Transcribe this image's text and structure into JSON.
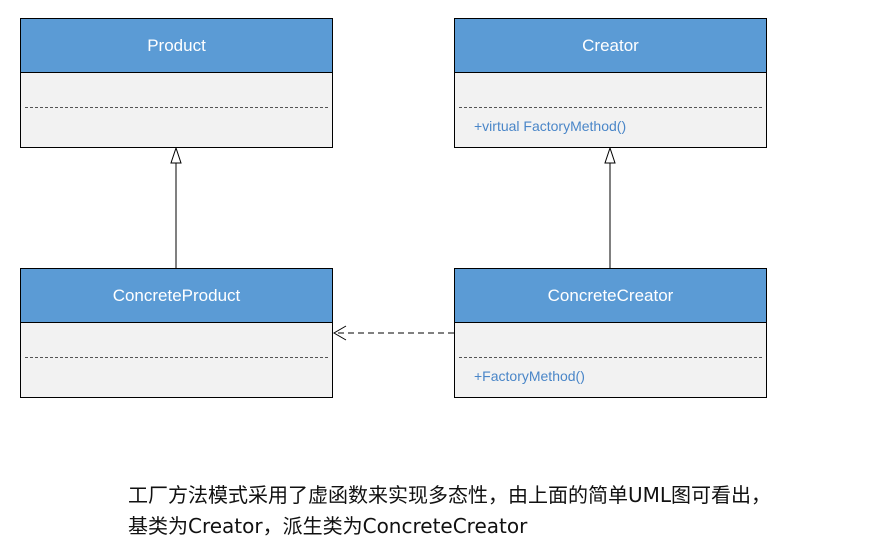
{
  "classes": {
    "product": {
      "name": "Product",
      "operation": ""
    },
    "creator": {
      "name": "Creator",
      "operation": "+virtual FactoryMethod()"
    },
    "concrete_product": {
      "name": "ConcreteProduct",
      "operation": ""
    },
    "concrete_creator": {
      "name": "ConcreteCreator",
      "operation": "+FactoryMethod()"
    }
  },
  "caption": {
    "line1": "工厂方法模式采用了虚函数来实现多态性，由上面的简单UML图可看出，",
    "line2": "基类为Creator，派生类为ConcreteCreator"
  },
  "colors": {
    "header": "#5b9bd5",
    "body": "#f2f2f2",
    "operation_text": "#4a86c8"
  }
}
